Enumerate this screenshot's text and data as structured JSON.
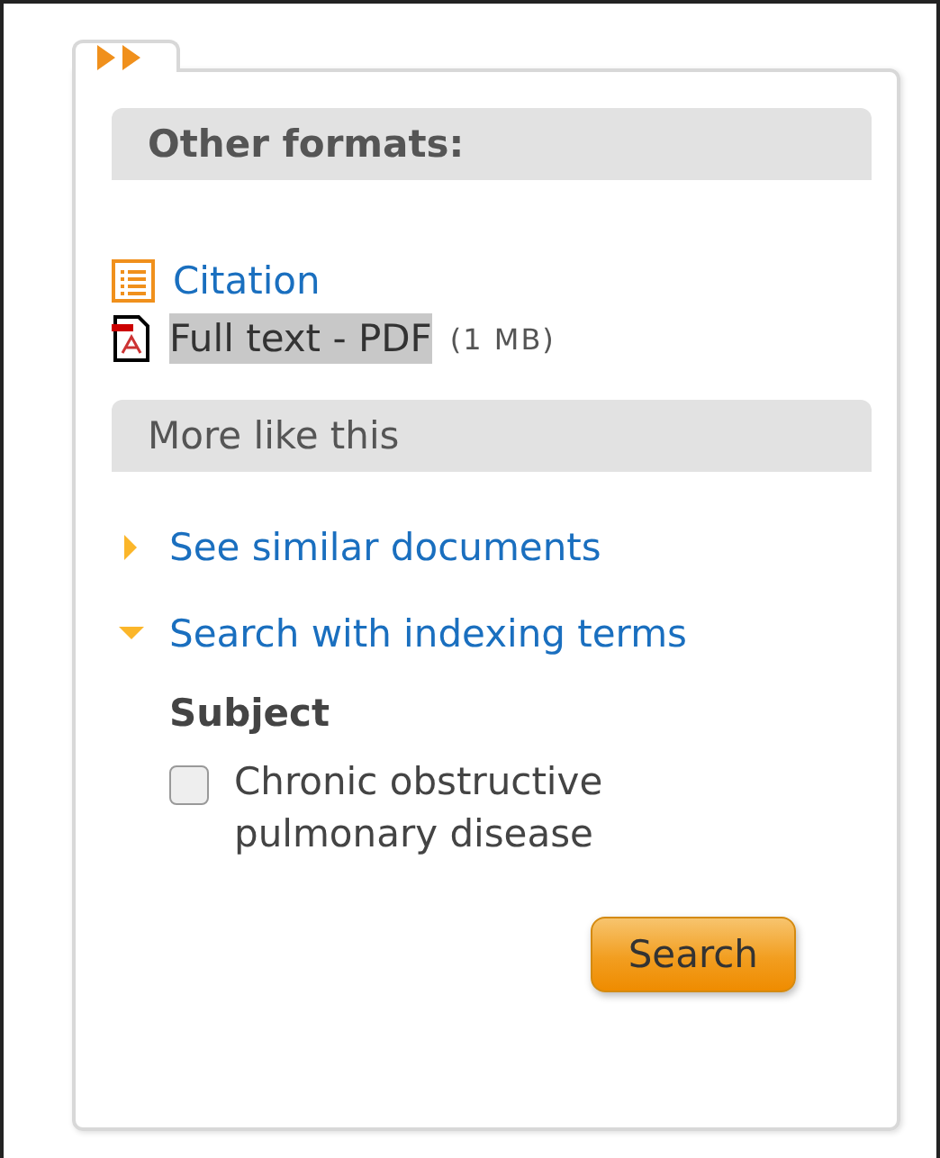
{
  "formats": {
    "heading": "Other formats:",
    "links": [
      {
        "kind": "citation",
        "label": "Citation",
        "highlighted": false
      },
      {
        "kind": "pdf",
        "label": "Full text - PDF",
        "size": "(1 MB)",
        "highlighted": true
      }
    ]
  },
  "more": {
    "heading": "More like this",
    "sections": [
      {
        "label": "See similar documents",
        "expanded": false
      },
      {
        "label": "Search with indexing terms",
        "expanded": true
      }
    ]
  },
  "subject": {
    "heading": "Subject",
    "terms": [
      {
        "label": "Chronic obstructive pulmonary disease",
        "checked": false
      }
    ]
  },
  "button": "Search"
}
